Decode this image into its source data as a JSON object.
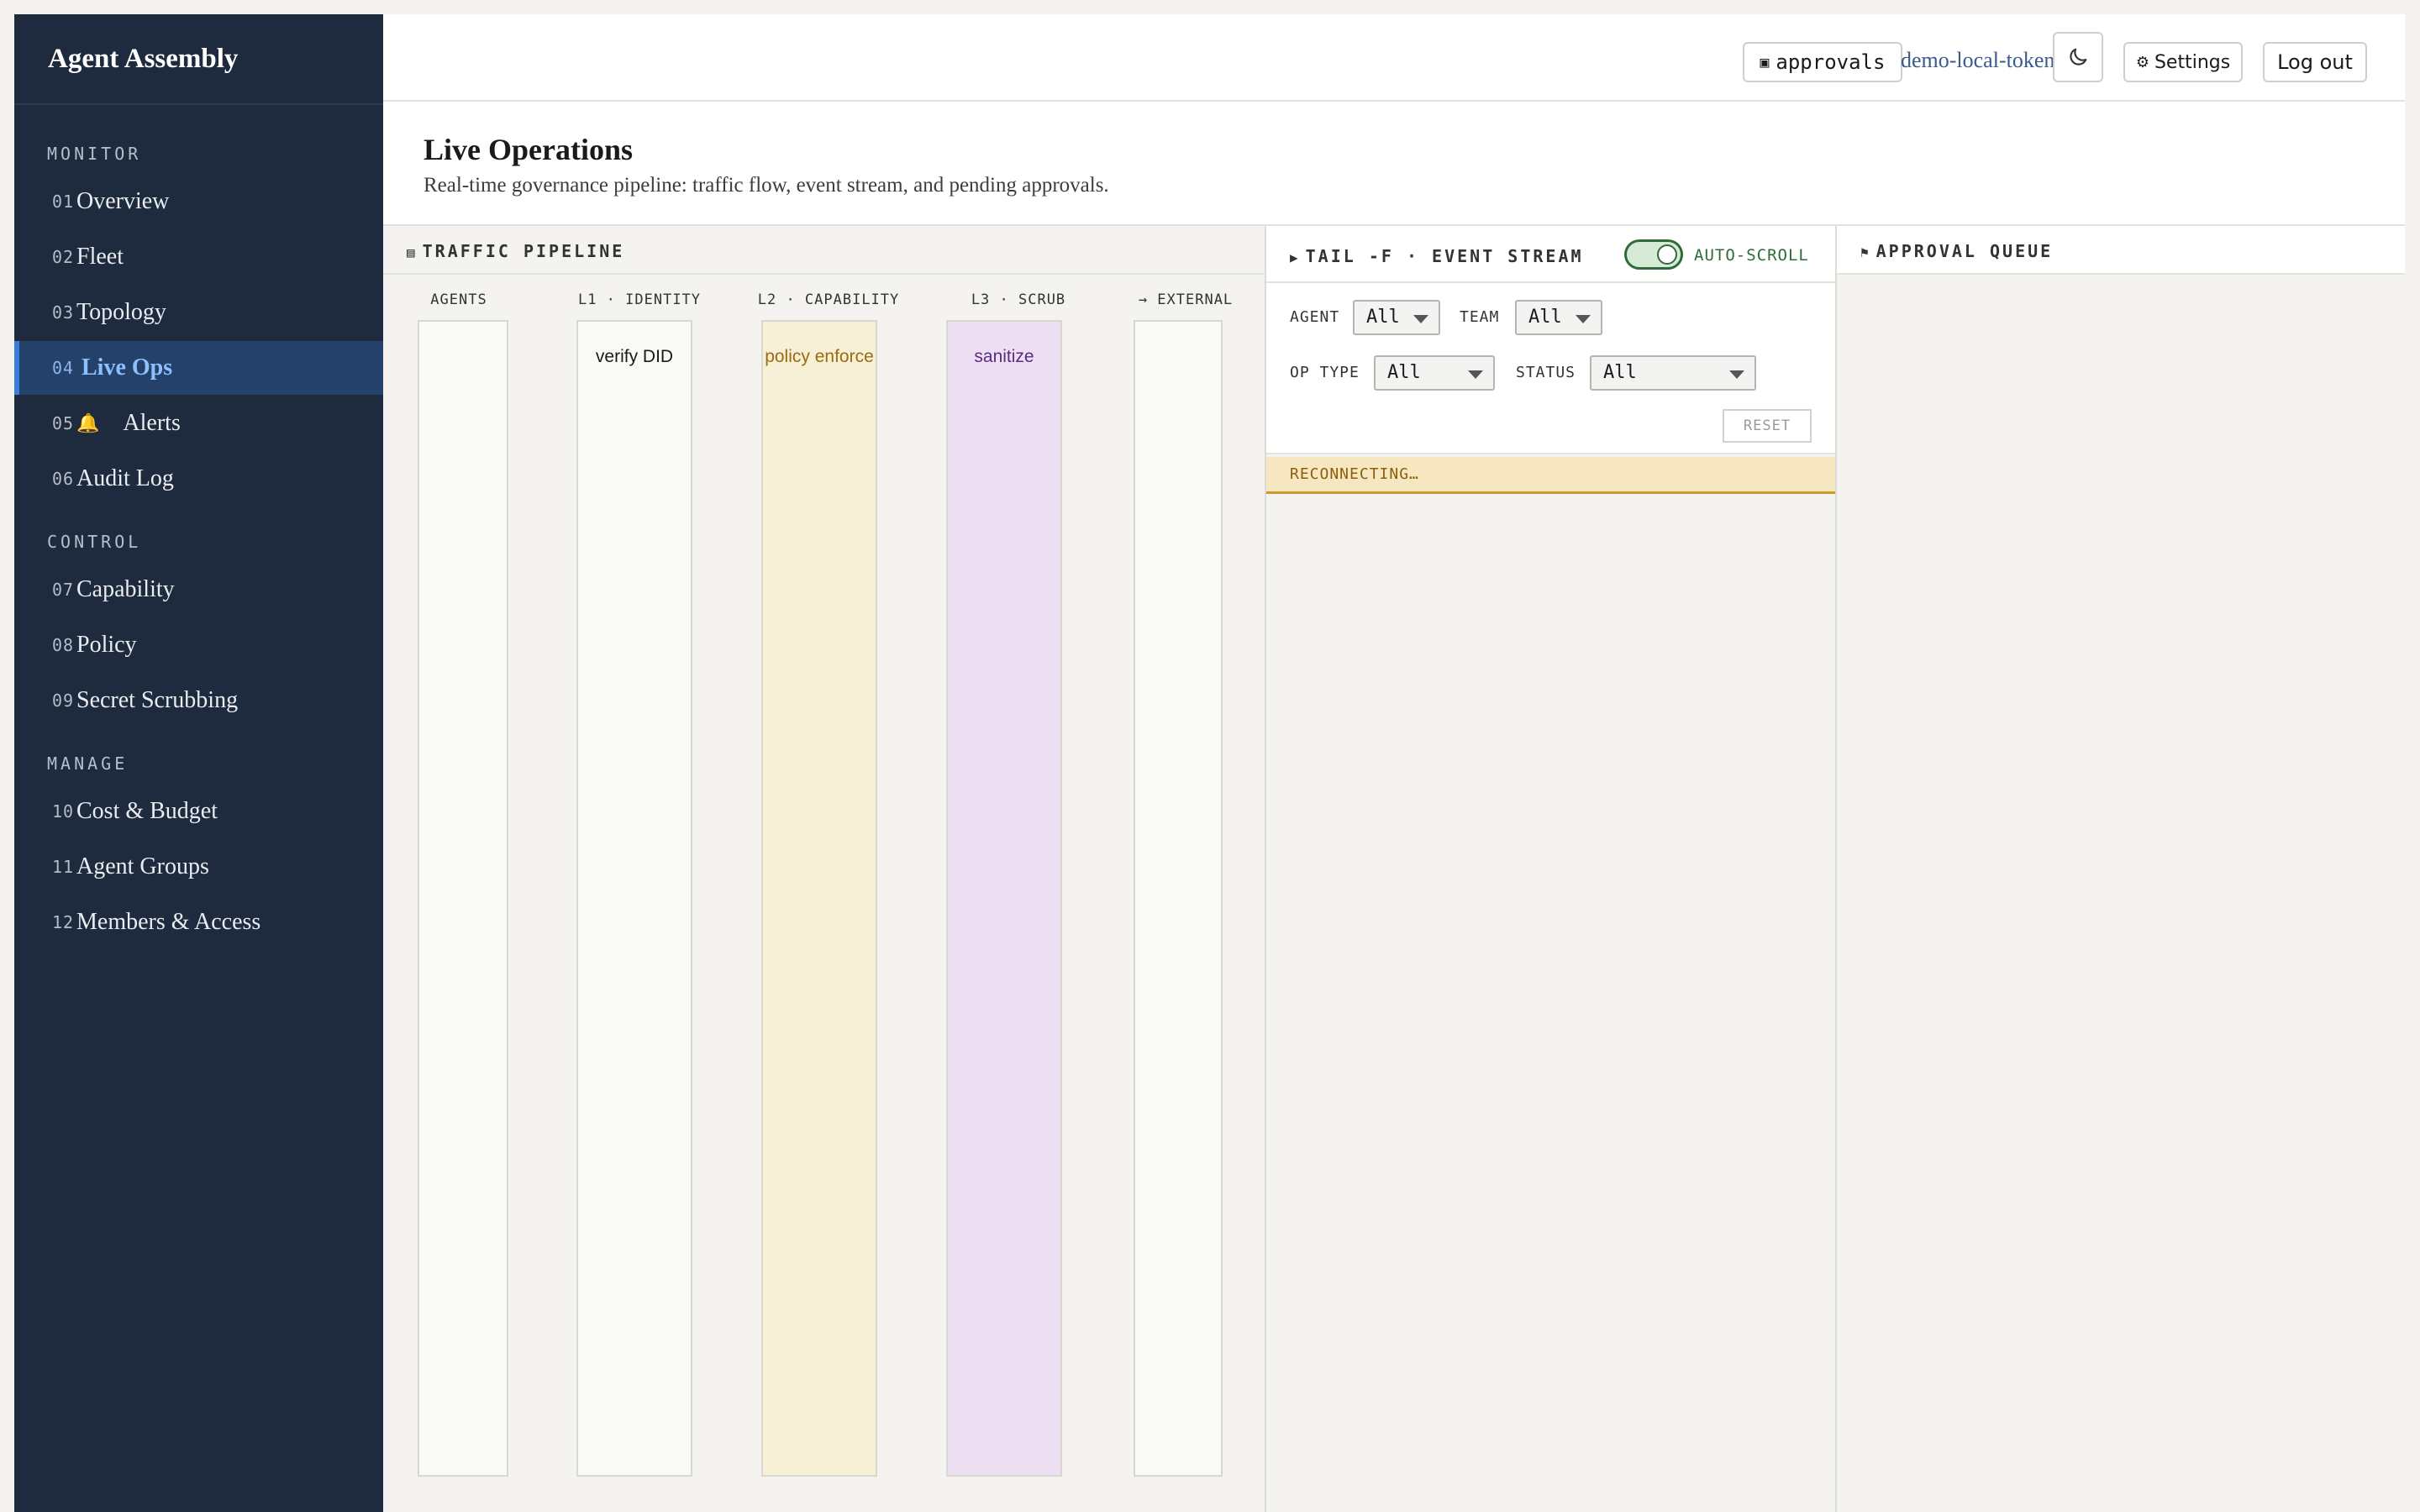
{
  "brand": "Agent Assembly",
  "nav": {
    "sections": [
      {
        "title": "MONITOR"
      },
      {
        "title": "CONTROL"
      },
      {
        "title": "MANAGE"
      }
    ],
    "items": [
      {
        "num": "01",
        "label": "Overview"
      },
      {
        "num": "02",
        "label": "Fleet"
      },
      {
        "num": "03",
        "label": "Topology"
      },
      {
        "num": "04",
        "label": "Live Ops",
        "active": true
      },
      {
        "num": "05",
        "label": "Alerts",
        "icon": "bell-icon",
        "icon_glyph": "🔔"
      },
      {
        "num": "06",
        "label": "Audit Log"
      },
      {
        "num": "07",
        "label": "Capability"
      },
      {
        "num": "08",
        "label": "Policy"
      },
      {
        "num": "09",
        "label": "Secret Scrubbing"
      },
      {
        "num": "10",
        "label": "Cost & Budget"
      },
      {
        "num": "11",
        "label": "Agent Groups"
      },
      {
        "num": "12",
        "label": "Members & Access"
      }
    ]
  },
  "topbar": {
    "context_chip": "approvals",
    "context_chip_icon": "▣",
    "token_link": "demo-local-token",
    "theme_icon": "moon-icon",
    "settings_label": "Settings",
    "settings_icon": "⚙",
    "logout_label": "Log out"
  },
  "page": {
    "title": "Live Operations",
    "subtitle": "Real-time governance pipeline: traffic flow, event stream, and pending approvals."
  },
  "traffic": {
    "header": "TRAFFIC PIPELINE",
    "header_icon": "▤",
    "lanes": [
      {
        "label": "AGENTS",
        "content": ""
      },
      {
        "label": "L1 · IDENTITY",
        "content": "verify DID"
      },
      {
        "label": "L2 · CAPABILITY",
        "content": "policy enforce"
      },
      {
        "label": "L3 · SCRUB",
        "content": "sanitize"
      },
      {
        "label": "→ EXTERNAL",
        "content": ""
      }
    ]
  },
  "stream": {
    "header": "TAIL -F · EVENT STREAM",
    "header_icon": "▶",
    "autoscroll_label": "AUTO-SCROLL",
    "autoscroll_on": true,
    "filters": {
      "agent_label": "AGENT",
      "agent_value": "All",
      "team_label": "TEAM",
      "team_value": "All",
      "optype_label": "OP TYPE",
      "optype_value": "All",
      "status_label": "STATUS",
      "status_value": "All"
    },
    "reset_label": "RESET",
    "status_banner": "RECONNECTING…",
    "status_color": "#f6e7c0"
  },
  "approval": {
    "header": "APPROVAL QUEUE",
    "header_icon": "⚑"
  }
}
